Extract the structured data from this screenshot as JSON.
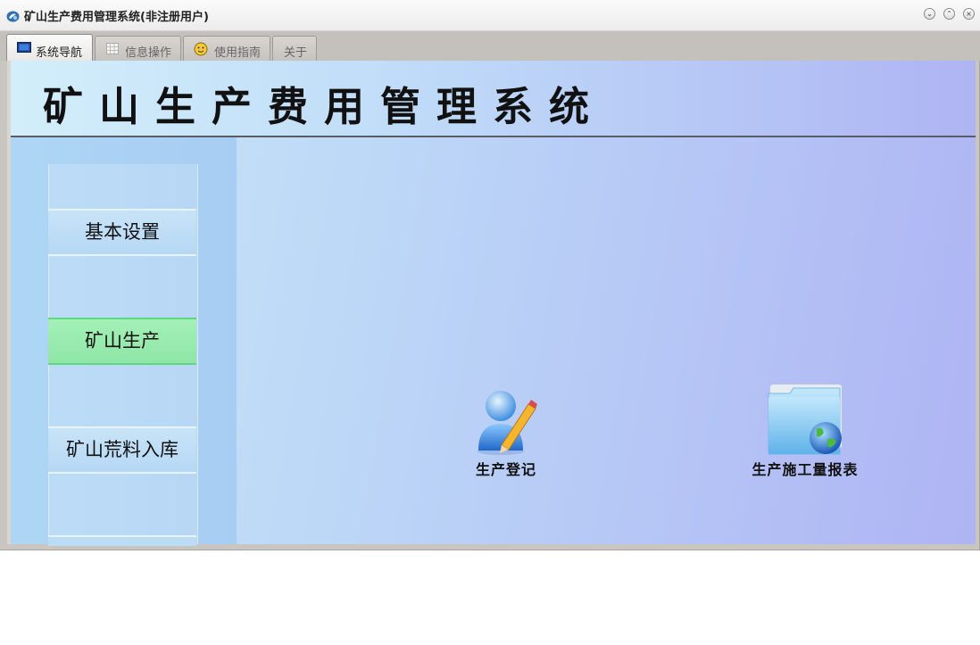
{
  "window": {
    "title": "矿山生产费用管理系统(非注册用户)",
    "icon": "app-logo-icon",
    "controls": [
      "minimize-icon",
      "maximize-icon",
      "close-icon"
    ]
  },
  "tabs": [
    {
      "label": "系统导航",
      "icon": "monitor-icon",
      "active": true
    },
    {
      "label": "信息操作",
      "icon": "grid-icon",
      "active": false
    },
    {
      "label": "使用指南",
      "icon": "help-smiley-icon",
      "active": false
    },
    {
      "label": "关于",
      "icon": "",
      "active": false
    }
  ],
  "header": {
    "title": "矿山生产费用管理系统"
  },
  "sidebar": {
    "items": [
      {
        "label": "基本设置",
        "selected": false
      },
      {
        "label": "矿山生产",
        "selected": true
      },
      {
        "label": "矿山荒料入库",
        "selected": false
      }
    ]
  },
  "functions": [
    {
      "label": "生产登记",
      "icon": "user-edit-icon"
    },
    {
      "label": "生产施工量报表",
      "icon": "folder-globe-icon"
    }
  ],
  "colors": {
    "selected_green": "#99eaae",
    "panel_blue": "#b4c2f5"
  }
}
